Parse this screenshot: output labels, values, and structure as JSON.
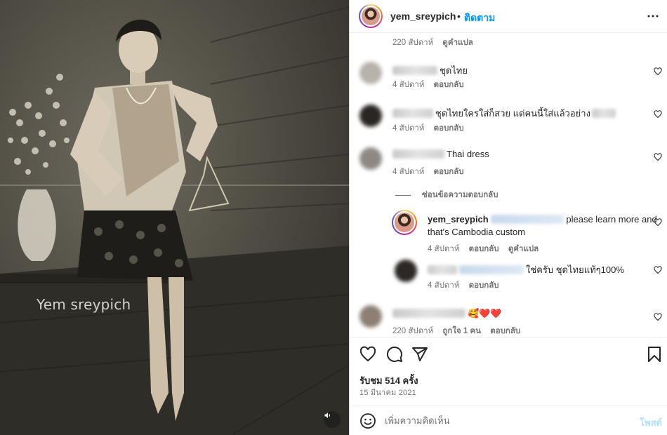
{
  "media": {
    "watermark": "Yem sreypich",
    "volume_icon": "volume-icon"
  },
  "header": {
    "username": "yem_sreypich",
    "dot": "•",
    "follow_label": "ติดตาม",
    "more_icon": "more-horizontal-icon"
  },
  "comments": [
    {
      "id": "c0",
      "text": "",
      "time": "220 สัปดาห์",
      "actions": [
        "ดูคำแปล"
      ]
    },
    {
      "id": "c1",
      "text": "ชุดไทย",
      "time": "4 สัปดาห์",
      "actions": [
        "ตอบกลับ"
      ]
    },
    {
      "id": "c2",
      "text": "ชุดไทยใครใส่ก็สวย แต่คนนี้ใส่แล้วอย่าง",
      "time": "4 สัปดาห์",
      "actions": [
        "ตอบกลับ"
      ]
    },
    {
      "id": "c3",
      "text": "Thai dress",
      "time": "4 สัปดาห์",
      "actions": [
        "ตอบกลับ"
      ]
    },
    {
      "id": "r1",
      "username": "yem_sreypich",
      "text_line1": "please learn more and",
      "text_line2": "that's Cambodia custom",
      "time": "4 สัปดาห์",
      "actions": [
        "ตอบกลับ",
        "ดูคำแปล"
      ]
    },
    {
      "id": "r2",
      "text": "ใช่ครับ ชุดไทยแท้ๆ100%",
      "time": "4 สัปดาห์",
      "actions": [
        "ตอบกลับ"
      ]
    },
    {
      "id": "c4",
      "text": "🥰❤️❤️",
      "time": "220 สัปดาห์",
      "likes": "ถูกใจ 1 คน",
      "actions": [
        "ตอบกลับ"
      ]
    }
  ],
  "hide_replies": "ซ่อนข้อความตอบกลับ",
  "actions": {
    "like_icon": "heart-icon",
    "comment_icon": "comment-icon",
    "share_icon": "share-icon",
    "save_icon": "bookmark-icon",
    "views": "รับชม 514 ครั้ง",
    "date": "15 มีนาคม 2021"
  },
  "compose": {
    "emoji_icon": "emoji-icon",
    "placeholder": "เพิ่มความคิดเห็น",
    "post_label": "โพสต์"
  },
  "colors": {
    "accent": "#0095f6",
    "post_disabled": "#b2dffc",
    "text": "#262626",
    "secondary": "#737373"
  }
}
